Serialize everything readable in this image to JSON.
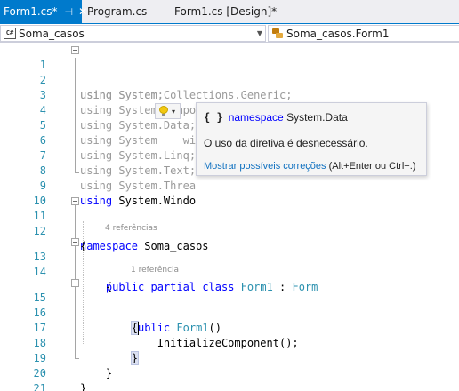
{
  "tabs": [
    {
      "label": "Form1.cs*",
      "pin": "⊣",
      "close": "✕",
      "active": true
    },
    {
      "label": "Program.cs",
      "close": "✕",
      "active": false
    },
    {
      "label": "Form1.cs [Design]*",
      "active": false
    }
  ],
  "navbar": {
    "project": "Soma_casos",
    "class_member": "Soma_casos.Form1",
    "project_icon": "C#"
  },
  "code": {
    "lines": [
      {
        "n": "1"
      },
      {
        "n": "2"
      },
      {
        "n": "3"
      },
      {
        "n": "4"
      },
      {
        "n": "5"
      },
      {
        "n": "6"
      },
      {
        "n": "7"
      },
      {
        "n": "8"
      },
      {
        "n": "9"
      },
      {
        "n": "10"
      },
      {
        "n": "11"
      },
      {
        "n": "12"
      },
      {
        "n": "13"
      },
      {
        "n": "14"
      },
      {
        "n": "15"
      },
      {
        "n": "16"
      },
      {
        "n": "17"
      },
      {
        "n": "18"
      },
      {
        "n": "19"
      },
      {
        "n": "20"
      },
      {
        "n": "21"
      }
    ],
    "using_kw": "using",
    "usings": [
      "System;",
      "System.Collections.Generic;",
      "System.ComponentModel;",
      "System.Data;",
      "System",
      "System.Linq;",
      "System.Text;",
      "System.Threa",
      "System.Windo"
    ],
    "using5_tail": "wi",
    "ns_kw": "namespace",
    "ns_name": "Soma_casos",
    "open_brace": "{",
    "close_brace": "}",
    "lens_class": "4 referências",
    "class_line": {
      "public": "public",
      "partial": "partial",
      "class": "class",
      "name": "Form1",
      "colon": " : ",
      "base": "Form"
    },
    "lens_ctor": "1 referência",
    "ctor_line": {
      "public": "public",
      "name": "Form1",
      "parens": "()"
    },
    "init_call": "InitializeComponent();"
  },
  "lightbulb": {
    "icon": "lightbulb-icon",
    "arrow": "▾"
  },
  "popup": {
    "ns_icon": "{ }",
    "kw": "namespace",
    "symbol": "System.Data",
    "message": "O uso da diretiva é desnecessário.",
    "link": "Mostrar possíveis correções",
    "shortcut": "(Alt+Enter ou Ctrl+.)"
  },
  "colors": {
    "accent": "#007acc",
    "keyword": "#0000ff",
    "type": "#2b91af",
    "line_number": "#2b91af",
    "link": "#0e70c0"
  }
}
